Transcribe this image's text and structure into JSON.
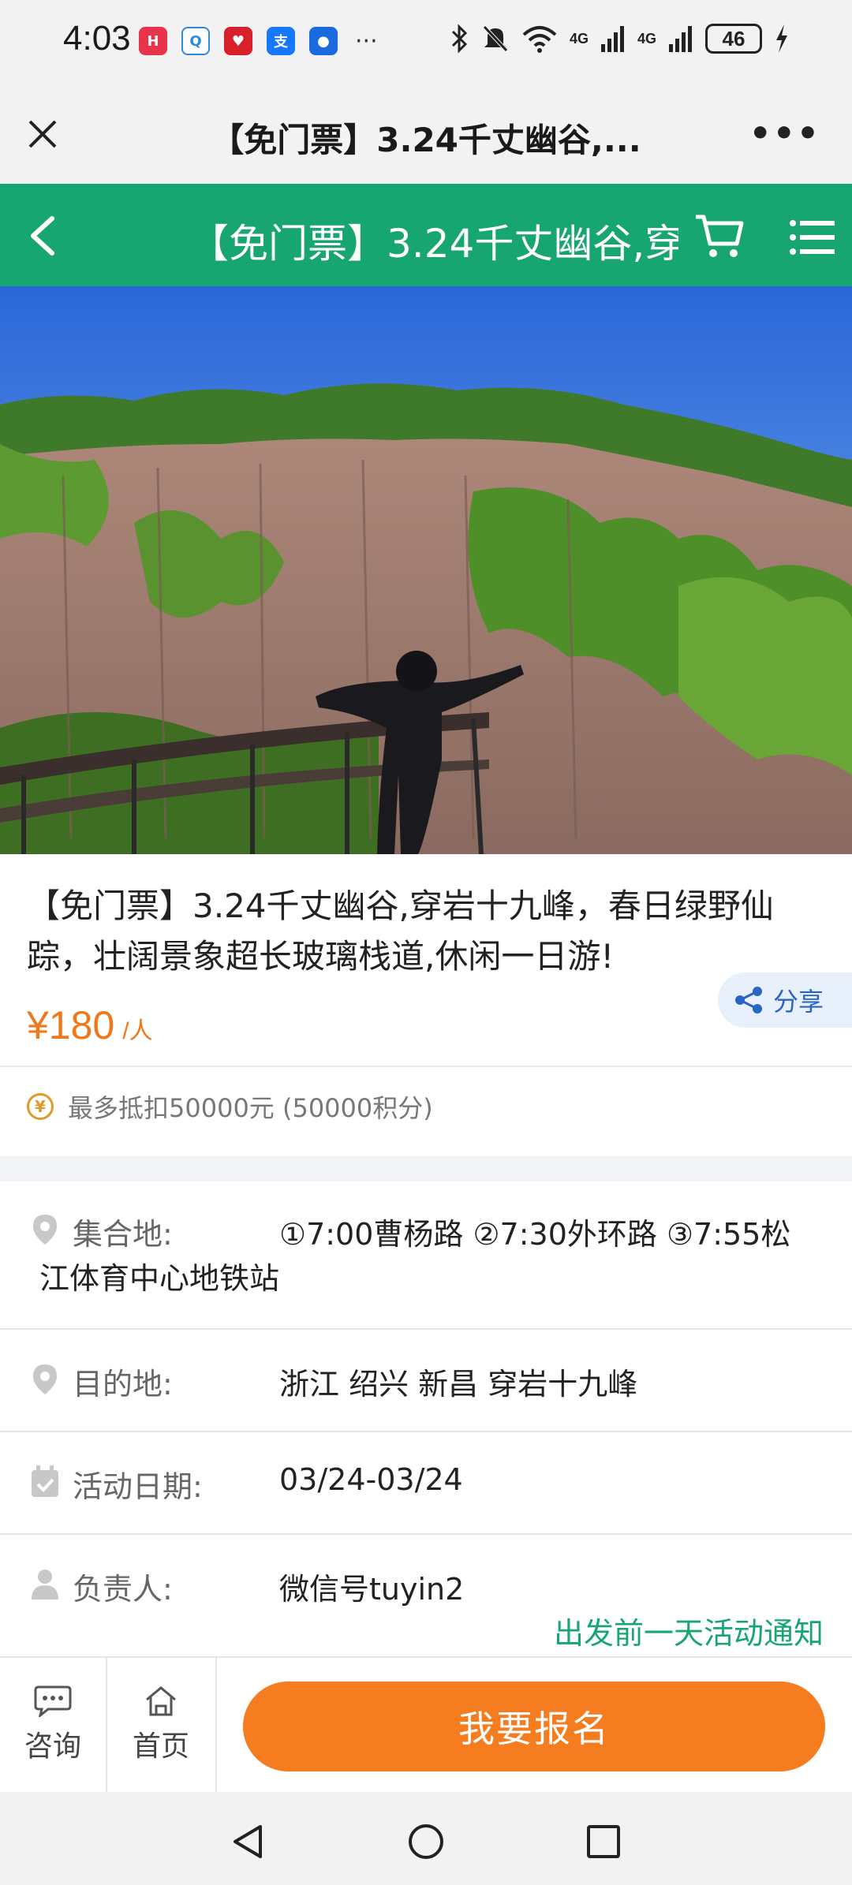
{
  "status": {
    "time": "4:03",
    "battery": "46",
    "more": "···",
    "network": [
      "4G",
      "4G"
    ]
  },
  "titlebar": {
    "title": "【免门票】3.24千丈幽谷,..."
  },
  "header": {
    "title": "【免门票】3.24千丈幽谷,穿"
  },
  "event": {
    "title": "【免门票】3.24千丈幽谷,穿岩十九峰，春日绿野仙踪，壮阔景象超长玻璃栈道,休闲一日游!",
    "price": "¥180",
    "price_unit": "/人",
    "share_label": "分享",
    "points_text": "最多抵扣50000元 (50000积分)"
  },
  "details": {
    "meeting_label": "集合地:",
    "meeting_value_line1": "①7:00曹杨路 ②7:30外环路 ③7:55松",
    "meeting_value_line2": "江体育中心地铁站",
    "destination_label": "目的地:",
    "destination_value": "浙江 绍兴 新昌 穿岩十九峰",
    "date_label": "活动日期:",
    "date_value": "03/24-03/24",
    "contact_label": "负责人:",
    "contact_value": "微信号tuyin2",
    "notice": "出发前一天活动通知"
  },
  "bottom": {
    "consult_label": "咨询",
    "home_label": "首页",
    "signup_label": "我要报名"
  },
  "colors": {
    "green": "#17a571",
    "orange": "#f57c1f",
    "price": "#f0781a"
  }
}
